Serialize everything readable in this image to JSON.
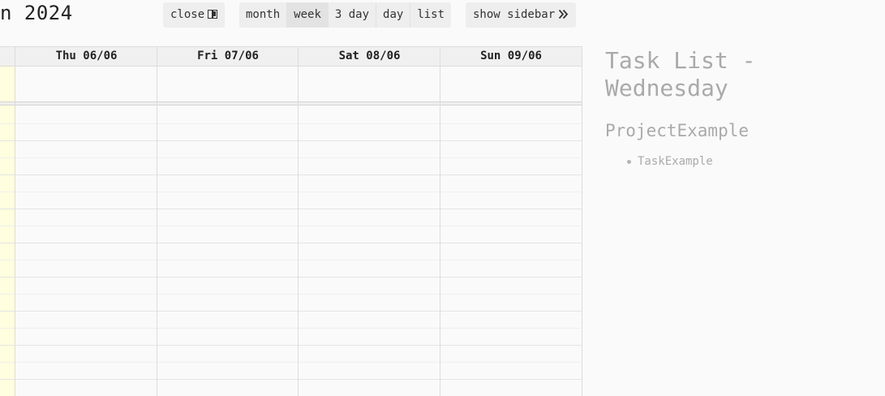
{
  "toolbar": {
    "title": "n 2024",
    "close_label": "close",
    "views": [
      {
        "label": "month",
        "active": false
      },
      {
        "label": "week",
        "active": true
      },
      {
        "label": "3 day",
        "active": false
      },
      {
        "label": "day",
        "active": false
      },
      {
        "label": "list",
        "active": false
      }
    ],
    "sidebar_toggle_label": "show sidebar"
  },
  "calendar": {
    "columns": [
      {
        "label": "Thu 06/06"
      },
      {
        "label": "Fri 07/06"
      },
      {
        "label": "Sat 08/06"
      },
      {
        "label": "Sun 09/06"
      }
    ],
    "today_color": "#fffedf"
  },
  "sidebar": {
    "title": "Task List - Wednesday",
    "project": "ProjectExample",
    "tasks": [
      "TaskExample"
    ]
  },
  "colors": {
    "button_bg": "#eeeeee",
    "active_button_bg": "#e3e3e3",
    "header_bg": "#f0f0f0",
    "grid_line": "#dcdcdc",
    "sidebar_text": "#aaaaaa"
  },
  "icons": {
    "close": "panel-close-icon",
    "sidebar": "double-chevron-right-icon"
  }
}
